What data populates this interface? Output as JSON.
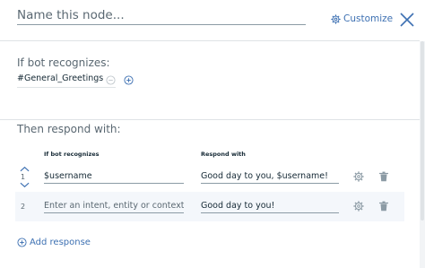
{
  "header": {
    "name_placeholder": "Name this node...",
    "customize_label": "Customize"
  },
  "conditions": {
    "title": "If bot recognizes:",
    "value": "#General_Greetings"
  },
  "responses": {
    "title": "Then respond with:",
    "col_condition": "If bot recognizes",
    "col_response": "Respond with",
    "rows": [
      {
        "num": "1",
        "condition": "$username",
        "response": "Good day to you, $username!"
      },
      {
        "num": "2",
        "condition": "",
        "condition_placeholder": "Enter an intent, entity or context va",
        "response": "Good day to you!"
      }
    ],
    "add_label": "Add response"
  },
  "colors": {
    "accent": "#3d70b2",
    "text": "#152935",
    "muted": "#5a6872",
    "row_alt": "#f4f7fb"
  },
  "icons": [
    "gear-icon",
    "close-icon",
    "minus-circle-icon",
    "plus-circle-icon",
    "chevron-up-icon",
    "chevron-down-icon",
    "trash-icon"
  ]
}
